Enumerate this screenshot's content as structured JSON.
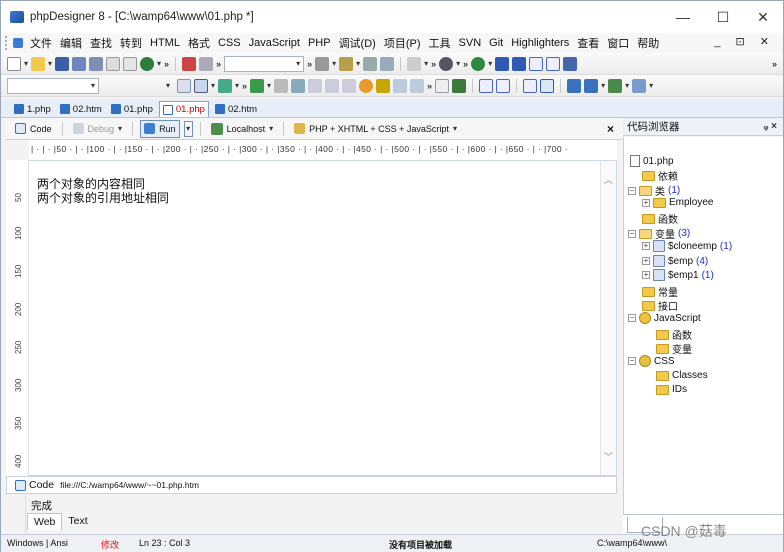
{
  "window": {
    "title": "phpDesigner 8 - [C:\\wamp64\\www\\01.php *]",
    "controls": [
      "—",
      "☐",
      "✕"
    ]
  },
  "menubar": {
    "items": [
      "文件",
      "编辑",
      "查找",
      "转到",
      "HTML",
      "格式",
      "CSS",
      "JavaScript",
      "PHP",
      "调试(D)",
      "项目(P)",
      "工具",
      "SVN",
      "Git",
      "Highlighters",
      "查看",
      "窗口",
      "帮助"
    ],
    "window_controls": "_ ⊡ ✕"
  },
  "doc_tabs": [
    {
      "label": "1.php",
      "active": false
    },
    {
      "label": "02.htm",
      "active": false
    },
    {
      "label": "01.php",
      "active": false
    },
    {
      "label": "01.php",
      "active": true
    },
    {
      "label": "02.htm",
      "active": false
    }
  ],
  "editor_toolbar": {
    "code_label": "Code",
    "debug_label": "Debug",
    "run_label": "Run",
    "localhost_label": "Localhost",
    "language_label": "PHP + XHTML + CSS + JavaScript",
    "close": "×"
  },
  "ruler": {
    "text": "| · | · |50 · | · |100 · | · |150 · | · |200 · | · |250 · | · |300 · | · |350 · | · |400 · | · |450 · | · |500 · | · |550 · | · |600 · | · |650 · | · |700 ·"
  },
  "gutter": {
    "ticks": [
      "50",
      "100",
      "150",
      "200",
      "250",
      "300",
      "350",
      "400"
    ]
  },
  "editor": {
    "lines": [
      "两个对象的内容相同",
      "两个对象的引用地址相同"
    ]
  },
  "codebar": {
    "code_label": "Code",
    "path": "file:///C:/wamp64/www/~~01.php.htm"
  },
  "output": {
    "status": "完成",
    "tabs": [
      {
        "label": "Web",
        "active": true
      },
      {
        "label": "Text",
        "active": false
      }
    ]
  },
  "statusbar": {
    "encoding": "Windows | Ansi",
    "modified": "修改",
    "position": "Ln    23 : Col  3",
    "project": "没有项目被加载",
    "path": "C:\\wamp64\\www\\"
  },
  "code_explorer": {
    "title": "代码浏览器",
    "pin": "ᵩ ×",
    "nodes": [
      {
        "label": "01.php",
        "count": ""
      },
      {
        "label": "依赖",
        "count": ""
      },
      {
        "label": "类",
        "count": "(1)"
      },
      {
        "label": "Employee",
        "count": ""
      },
      {
        "label": "函数",
        "count": ""
      },
      {
        "label": "变量",
        "count": "(3)"
      },
      {
        "label": "$cloneemp",
        "count": "(1)"
      },
      {
        "label": "$emp",
        "count": "(4)"
      },
      {
        "label": "$emp1",
        "count": "(1)"
      },
      {
        "label": "常量",
        "count": ""
      },
      {
        "label": "接口",
        "count": ""
      },
      {
        "label": "JavaScript",
        "count": ""
      },
      {
        "label": "函数",
        "count": ""
      },
      {
        "label": "变量",
        "count": ""
      },
      {
        "label": "CSS",
        "count": ""
      },
      {
        "label": "Classes",
        "count": ""
      },
      {
        "label": "IDs",
        "count": ""
      }
    ]
  },
  "watermark": "CSDN @菇毒"
}
